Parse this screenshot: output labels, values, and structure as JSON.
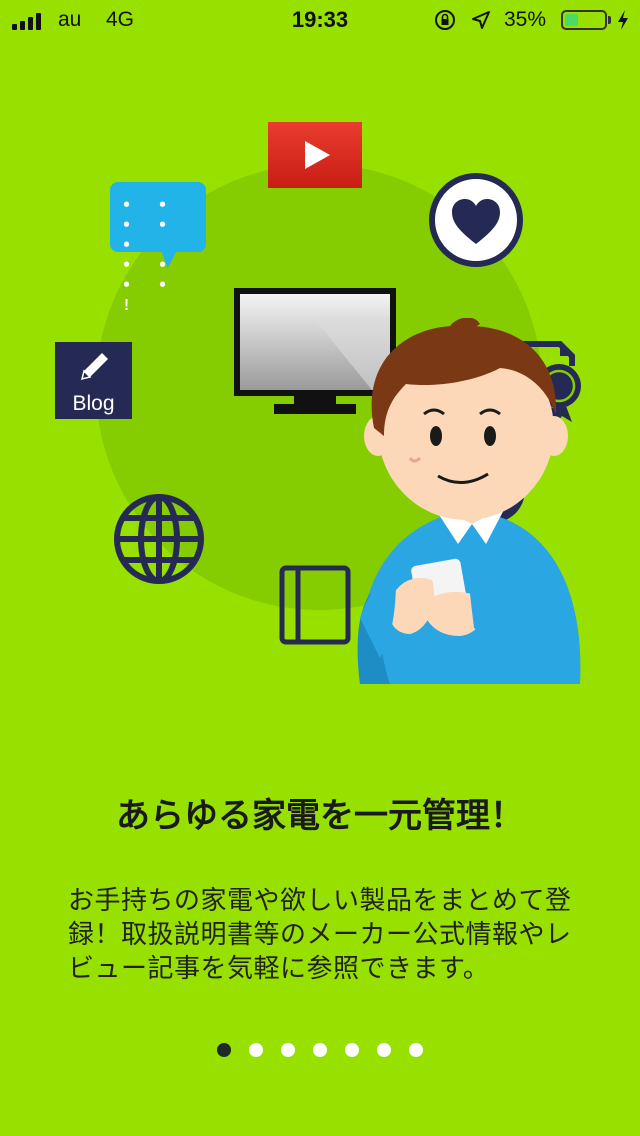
{
  "status_bar": {
    "carrier": "au",
    "network": "4G",
    "time": "19:33",
    "battery_percent": "35%",
    "battery_level": 0.35,
    "icons": [
      "signal-icon",
      "orientation-lock-icon",
      "location-icon",
      "battery-icon",
      "charging-icon"
    ]
  },
  "illustration": {
    "blog_label": "Blog",
    "chat_dots": "• • • • •\n• • • • !",
    "icons": [
      "youtube-play-icon",
      "chat-bubble-icon",
      "heart-icon",
      "tv-icon",
      "blog-icon",
      "certificate-icon",
      "globe-icon",
      "book-icon",
      "person-with-phone"
    ],
    "colors": {
      "background": "#97e000",
      "circle": "#85cc00",
      "navy": "#252a55",
      "youtube_red": "#e0281e",
      "chat_blue": "#22b4e8"
    }
  },
  "onboarding": {
    "title": "あらゆる家電を一元管理！",
    "description": "お手持ちの家電や欲しい製品をまとめて登録！取扱説明書等のメーカー公式情報やレビュー記事を気軽に参照できます。"
  },
  "pager": {
    "total": 7,
    "current": 1
  }
}
